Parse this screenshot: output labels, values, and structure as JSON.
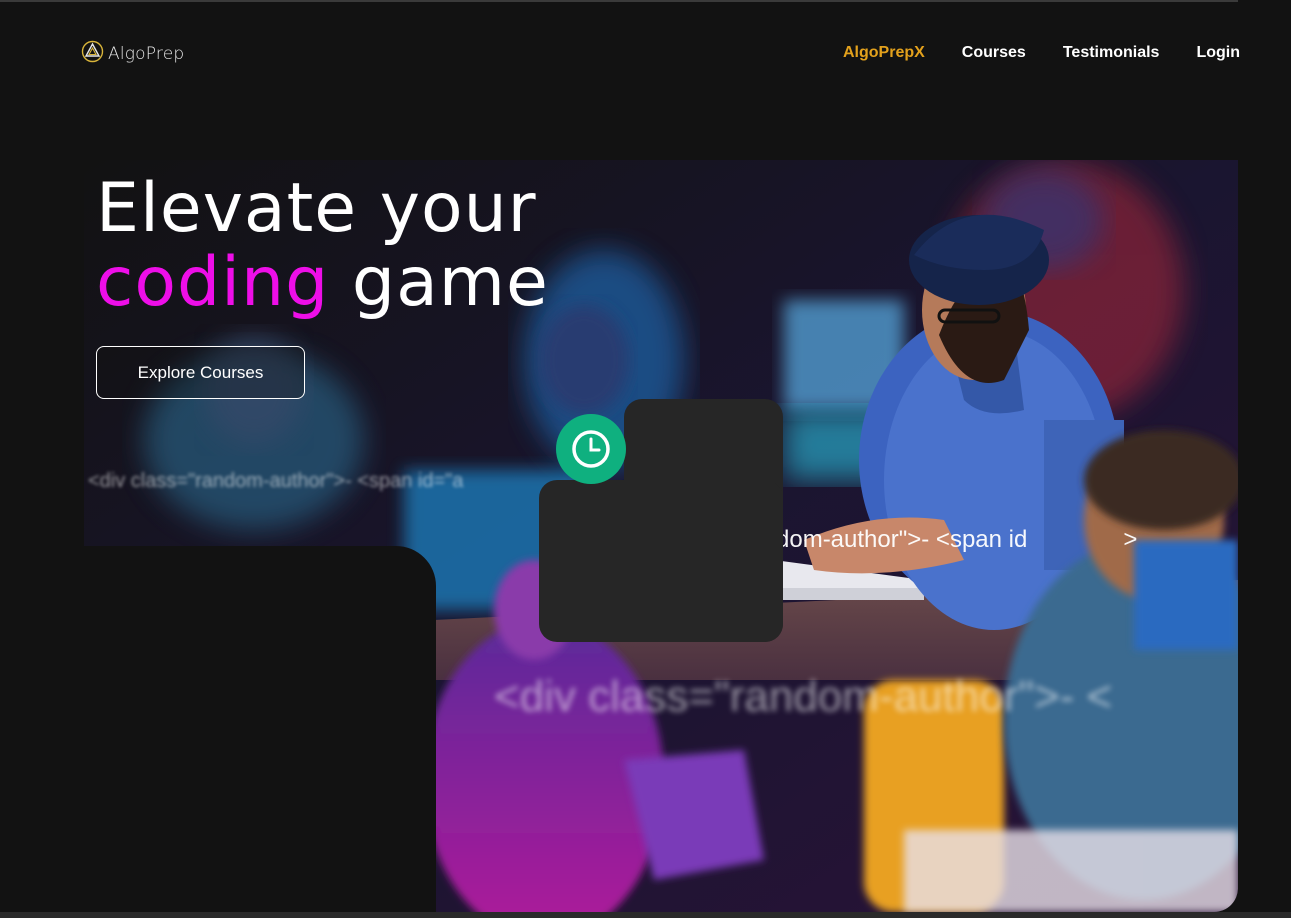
{
  "brand": {
    "name": "AlgoPrep",
    "icon": "algoprep-logo-icon"
  },
  "nav": {
    "items": [
      {
        "label": "AlgoPrepX",
        "active": true
      },
      {
        "label": "Courses",
        "active": false
      },
      {
        "label": "Testimonials",
        "active": false
      },
      {
        "label": "Login",
        "active": false
      }
    ]
  },
  "hero": {
    "title_line1": "Elevate your",
    "title_accent": "coding",
    "title_rest": " game",
    "cta_label": "Explore Courses"
  },
  "code_snippets": {
    "left": "<div class=\"random-author\">- <span id=\"a",
    "middle": "dom-author\">- <span id",
    "middle_tail": ">",
    "bottom": "<div class=\"random-author\">- <"
  },
  "badge": {
    "icon": "clock-icon"
  },
  "colors": {
    "background": "#121212",
    "accent_magenta": "#ee0ee8",
    "nav_active": "#e3a11c",
    "badge_green": "#0fb07f",
    "card": "#262626"
  }
}
